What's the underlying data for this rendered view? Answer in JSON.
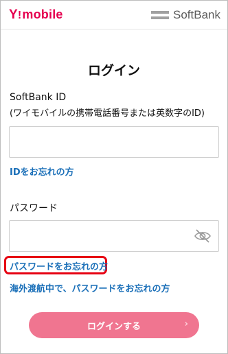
{
  "header": {
    "ymobile_logo": {
      "y": "Y",
      "bang": "!",
      "rest": "mobile"
    },
    "softbank_logo": "SoftBank"
  },
  "page": {
    "title": "ログイン"
  },
  "form": {
    "softbank_id_label": "SoftBank ID",
    "softbank_id_sublabel": "(ワイモバイルの携帯電話番号または英数字のID)",
    "softbank_id_value": "",
    "forgot_id_link": "IDをお忘れの方",
    "password_label": "パスワード",
    "password_value": "",
    "forgot_password_link": "パスワードをお忘れの方",
    "overseas_forgot_link": "海外渡航中で、パスワードをお忘れの方",
    "login_button": "ログインする",
    "login_button_arrow": "›"
  },
  "colors": {
    "brand_ymobile": "#e5004f",
    "link": "#1a6fb8",
    "highlight": "#e60012",
    "button": "#f07590"
  },
  "icons": {
    "password_toggle": "eye-slash-icon",
    "button_arrow": "chevron-right-icon"
  }
}
